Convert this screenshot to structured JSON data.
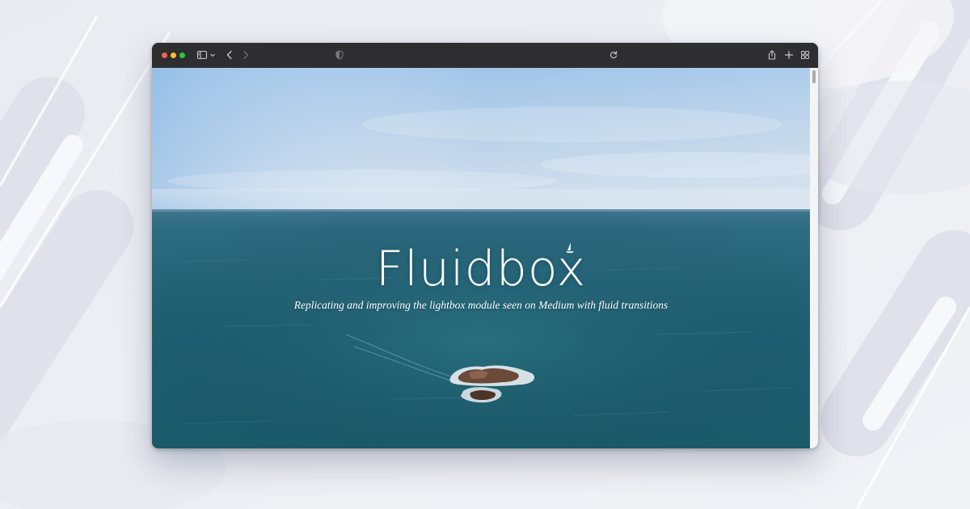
{
  "browser": {
    "traffic_light_colors": {
      "close": "#ff5f57",
      "minimize": "#febc2e",
      "zoom": "#28c840"
    },
    "toolbar_icons": [
      "sidebar-toggle-icon",
      "chevron-down-icon",
      "back-arrow-icon",
      "forward-arrow-icon",
      "privacy-shield-icon",
      "reload-icon",
      "share-icon",
      "new-tab-icon",
      "tab-overview-icon"
    ],
    "address_text": ""
  },
  "hero": {
    "title": "Fluidbox",
    "subtitle": "Replicating and improving the lightbox module seen on Medium with fluid transitions"
  }
}
